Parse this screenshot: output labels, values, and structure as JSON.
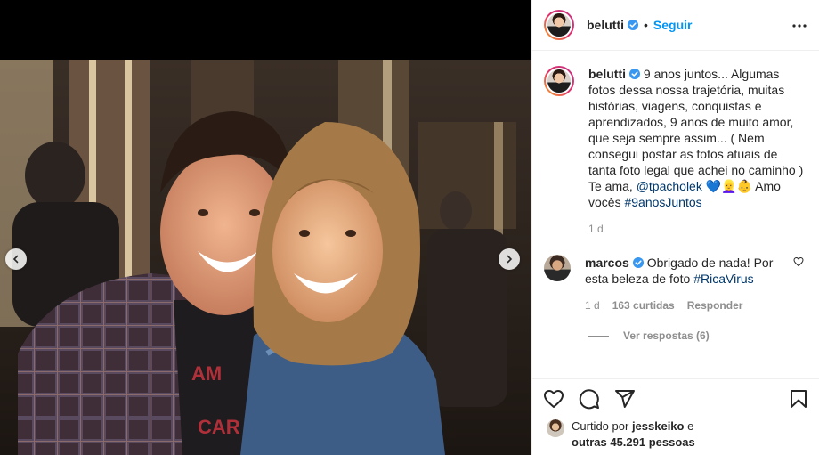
{
  "post": {
    "username": "belutti",
    "follow_label": "Seguir",
    "separator": "•",
    "caption": {
      "text": "9 anos juntos... Algumas fotos dessa nossa trajetória, muitas histórias, viagens, conquistas e aprendizados, 9 anos de muito amor, que seja sempre assim... ( Nem consegui postar as fotos atuais de tanta foto legal que achei no caminho )",
      "line2_prefix": "Te ama,",
      "mention": "@tpacholek",
      "emojis": "💙👱‍♀️👶",
      "line2_mid": "Amo vocês",
      "hashtag": "#9anosJuntos"
    },
    "time": "1 d"
  },
  "comment": {
    "username": "marcos",
    "text": "Obrigado de nada! Por esta beleza de foto",
    "hashtag": "#RicaVirus",
    "time": "1 d",
    "likes": "163 curtidas",
    "reply_label": "Responder",
    "view_replies": "Ver respostas (6)"
  },
  "likes": {
    "prefix": "Curtido por",
    "user": "jesskeiko",
    "middle": "e",
    "others": "outras 45.291 pessoas"
  },
  "icons": {
    "more": "more-horizontal-icon",
    "like": "heart-icon",
    "comment": "comment-icon",
    "share": "share-icon",
    "save": "bookmark-icon",
    "prev": "chevron-left-icon",
    "next": "chevron-right-icon",
    "verified": "verified-badge-icon"
  },
  "colors": {
    "accent": "#0095f6",
    "link": "#00376b",
    "muted": "#8e8e8e",
    "verified": "#3897f0"
  }
}
